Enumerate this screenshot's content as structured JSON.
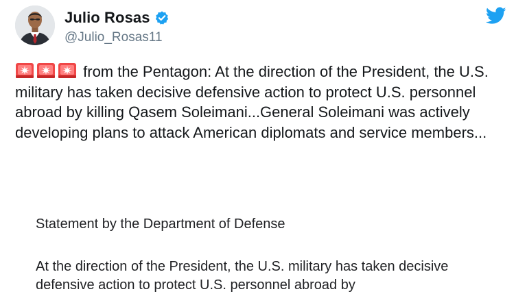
{
  "user": {
    "display_name": "Julio Rosas",
    "handle": "@Julio_Rosas11",
    "verified_icon": "verified-badge-icon",
    "avatar_icon": "avatar"
  },
  "brand": {
    "logo_icon": "twitter-bird-icon",
    "accent": "#1da1f2"
  },
  "tweet": {
    "emoji": [
      "siren-icon",
      "siren-icon",
      "siren-icon"
    ],
    "text": "from the Pentagon: At the direction of the President, the U.S. military has taken decisive defensive action to protect U.S. personnel abroad by killing Qasem Soleimani...General Soleimani was actively developing plans to attack American diplomats and service members..."
  },
  "statement": {
    "title": "Statement by the Department of Defense",
    "body": "At the direction of the President, the U.S. military has taken decisive defensive action to protect U.S. personnel abroad by"
  }
}
